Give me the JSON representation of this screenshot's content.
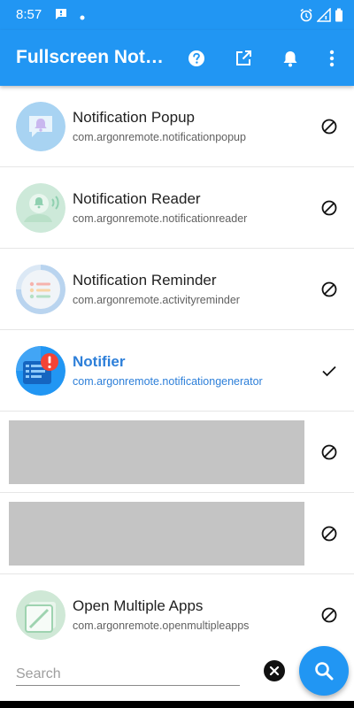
{
  "status_bar": {
    "time": "8:57",
    "icons": [
      "message-icon",
      "dot-icon",
      "alarm-icon",
      "signal-icon",
      "battery-icon"
    ]
  },
  "app_bar": {
    "title": "Fullscreen Notifications",
    "actions": [
      "help-icon",
      "open-external-icon",
      "bell-icon",
      "more-vert-icon"
    ]
  },
  "apps": [
    {
      "name": "Notification Popup",
      "package": "com.argonremote.notificationpopup",
      "status": "disabled",
      "icon": "notification-popup-app-icon"
    },
    {
      "name": "Notification Reader",
      "package": "com.argonremote.notificationreader",
      "status": "disabled",
      "icon": "notification-reader-app-icon"
    },
    {
      "name": "Notification Reminder",
      "package": "com.argonremote.activityreminder",
      "status": "disabled",
      "icon": "notification-reminder-app-icon"
    },
    {
      "name": "Notifier",
      "package": "com.argonremote.notificationgenerator",
      "status": "selected",
      "icon": "notifier-app-icon"
    },
    {
      "type": "ad",
      "status": "disabled"
    },
    {
      "type": "ad",
      "status": "disabled"
    },
    {
      "name": "Open Multiple Apps",
      "package": "com.argonremote.openmultipleapps",
      "status": "disabled",
      "icon": "open-multiple-apps-app-icon"
    }
  ],
  "search": {
    "placeholder": "Search",
    "value": ""
  },
  "colors": {
    "primary": "#2196f3",
    "selected_text": "#2d7fd9",
    "alert_red": "#f44336"
  }
}
